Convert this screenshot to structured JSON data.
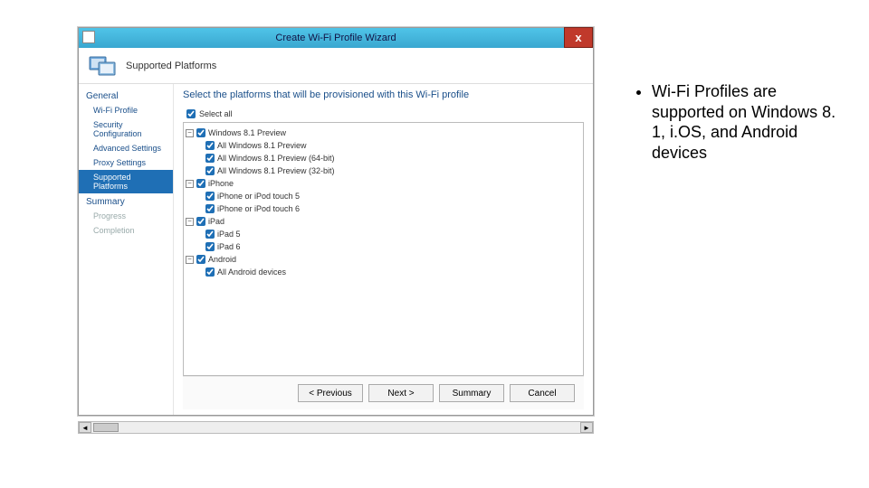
{
  "window": {
    "title": "Create Wi-Fi Profile Wizard",
    "close": "x"
  },
  "header": {
    "title": "Supported Platforms"
  },
  "nav": {
    "group_general": "General",
    "items": {
      "wifi_profile": "Wi-Fi Profile",
      "security_configuration": "Security Configuration",
      "advanced_settings": "Advanced Settings",
      "proxy_settings": "Proxy Settings",
      "supported_platforms": "Supported Platforms"
    },
    "summary": "Summary",
    "progress": "Progress",
    "completion": "Completion"
  },
  "content": {
    "instruction": "Select the platforms that will be provisioned with this Wi-Fi profile",
    "select_all": "Select all",
    "tree": {
      "win81": "Windows 8.1 Preview",
      "win81_all": "All Windows 8.1 Preview",
      "win81_64": "All Windows 8.1 Preview (64-bit)",
      "win81_32": "All Windows 8.1 Preview (32-bit)",
      "iphone": "iPhone",
      "iphone5": "iPhone or iPod touch 5",
      "iphone6": "iPhone or iPod touch 6",
      "ipad": "iPad",
      "ipad5": "iPad 5",
      "ipad6": "iPad 6",
      "android": "Android",
      "android_all": "All Android devices"
    }
  },
  "buttons": {
    "previous": "< Previous",
    "next": "Next >",
    "summary": "Summary",
    "cancel": "Cancel"
  },
  "sidenote": {
    "text": "Wi-Fi Profiles are supported on Windows 8. 1, i.OS, and Android devices"
  }
}
